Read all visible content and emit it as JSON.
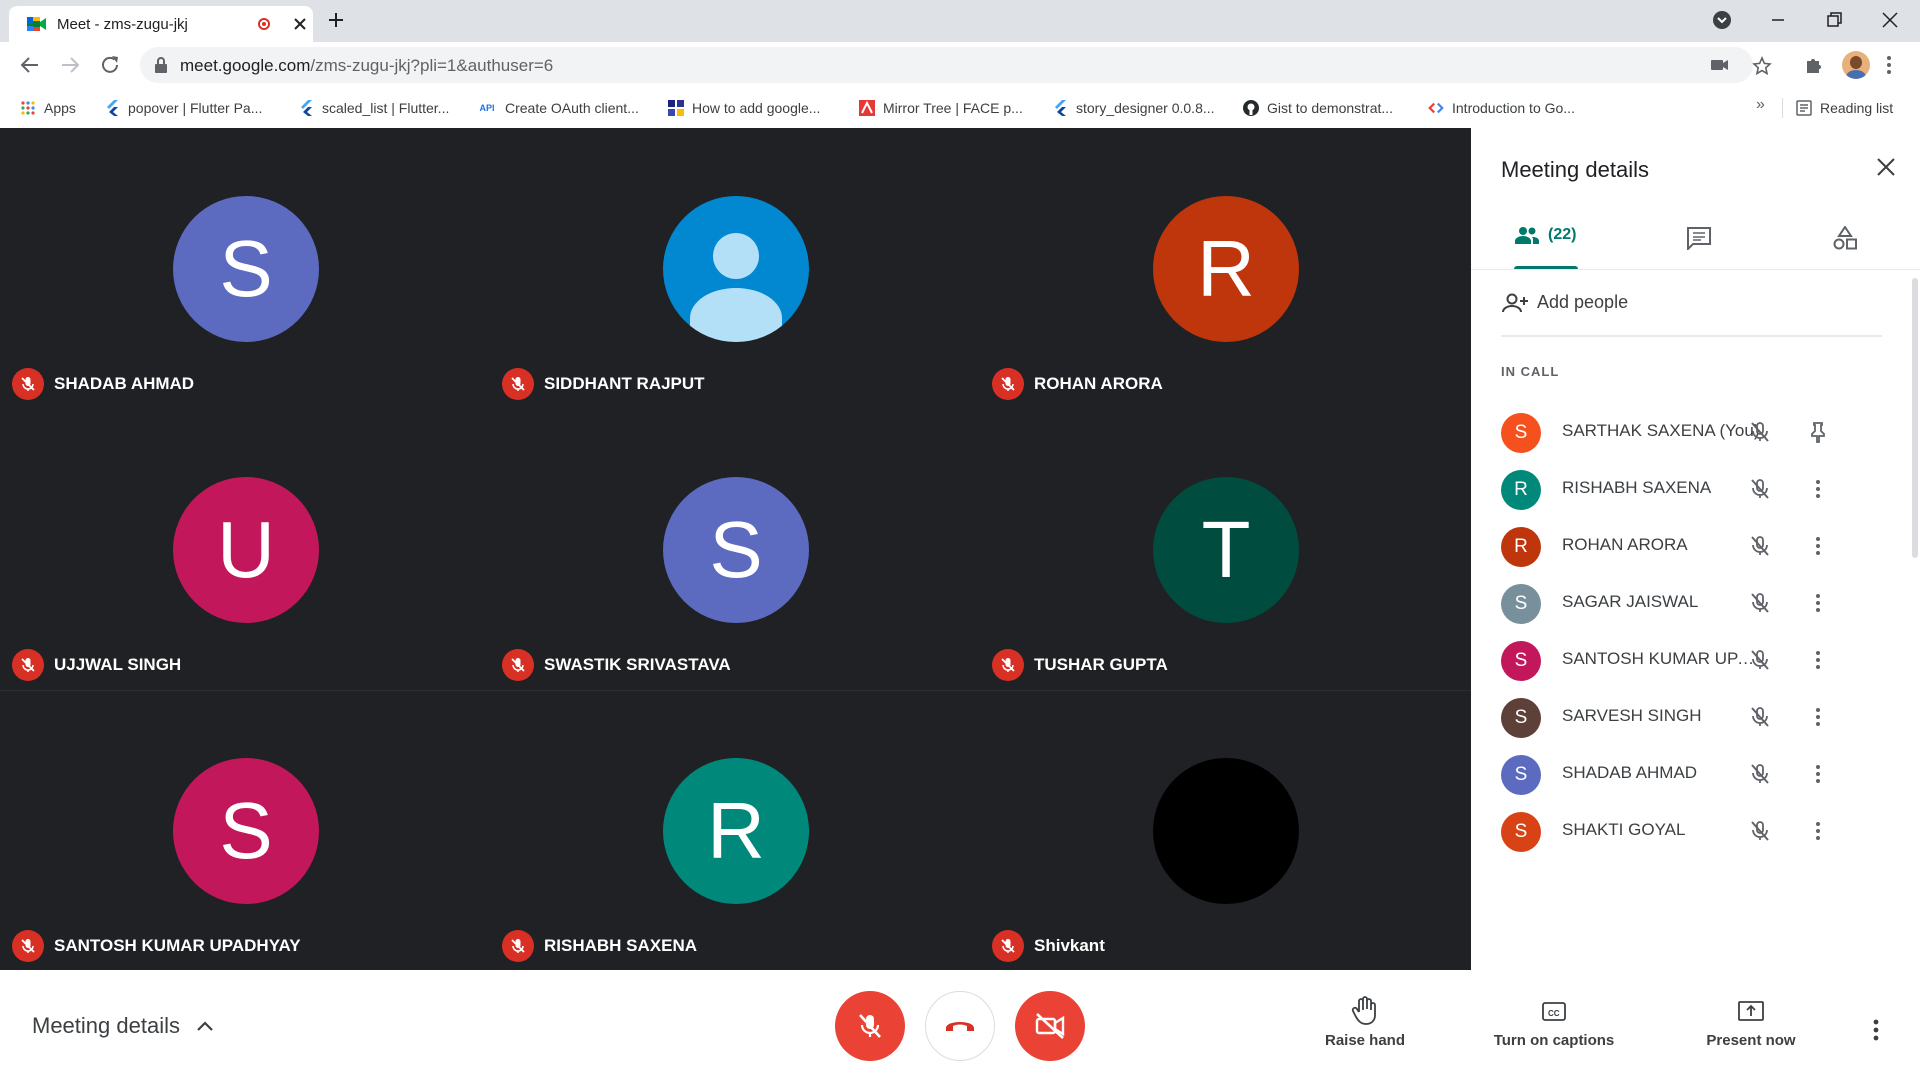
{
  "browser": {
    "tab_title": "Meet - zms-zugu-jkj",
    "url_host": "meet.google.com",
    "url_rest": "/zms-zugu-jkj?pli=1&authuser=6",
    "bookmarks": [
      {
        "label": "Apps",
        "icon": "apps-grid-icon"
      },
      {
        "label": "popover | Flutter Pa...",
        "icon": "flutter-icon"
      },
      {
        "label": "scaled_list | Flutter...",
        "icon": "flutter-icon"
      },
      {
        "label": "Create OAuth client...",
        "icon": "api-icon"
      },
      {
        "label": "How to add google...",
        "icon": "grid-icon"
      },
      {
        "label": "Mirror Tree | FACE p...",
        "icon": "mirror-tree-icon"
      },
      {
        "label": "story_designer 0.0.8...",
        "icon": "flutter-icon"
      },
      {
        "label": "Gist to demonstrat...",
        "icon": "github-icon"
      },
      {
        "label": "Introduction to Go...",
        "icon": "google-developers-icon"
      }
    ],
    "overflow": "»",
    "reading_list": "Reading list"
  },
  "tiles": [
    {
      "initial": "S",
      "name": "SHADAB AHMAD",
      "color": "#5c6bc0"
    },
    {
      "initial": "",
      "name": "SIDDHANT RAJPUT",
      "color": "#0288d1"
    },
    {
      "initial": "R",
      "name": "ROHAN ARORA",
      "color": "#bf360c"
    },
    {
      "initial": "U",
      "name": "UJJWAL SINGH",
      "color": "#c2185b"
    },
    {
      "initial": "S",
      "name": "SWASTIK SRIVASTAVA",
      "color": "#5c6bc0"
    },
    {
      "initial": "T",
      "name": "TUSHAR GUPTA",
      "color": "#004d40"
    },
    {
      "initial": "S",
      "name": "SANTOSH KUMAR UPADHYAY",
      "color": "#c2185b"
    },
    {
      "initial": "R",
      "name": "RISHABH SAXENA",
      "color": "#00897b"
    },
    {
      "initial": "",
      "name": "Shivkant",
      "color": "#000000"
    }
  ],
  "panel": {
    "title": "Meeting details",
    "people_count": "(22)",
    "add_people": "Add people",
    "in_call": "IN CALL",
    "participants": [
      {
        "initial": "S",
        "name": "SARTHAK SAXENA (You)",
        "color": "#f4511e",
        "action": "pin"
      },
      {
        "initial": "R",
        "name": "RISHABH SAXENA",
        "color": "#00897b",
        "action": "more"
      },
      {
        "initial": "R",
        "name": "ROHAN ARORA",
        "color": "#bf360c",
        "action": "more"
      },
      {
        "initial": "S",
        "name": "SAGAR JAISWAL",
        "color": "#78909c",
        "action": "more"
      },
      {
        "initial": "S",
        "name": "SANTOSH KUMAR UPA...",
        "color": "#c2185b",
        "action": "more"
      },
      {
        "initial": "S",
        "name": "SARVESH SINGH",
        "color": "#5d4037",
        "action": "more"
      },
      {
        "initial": "S",
        "name": "SHADAB AHMAD",
        "color": "#5c6bc0",
        "action": "more"
      },
      {
        "initial": "S",
        "name": "SHAKTI GOYAL",
        "color": "#d84315",
        "action": "more"
      }
    ]
  },
  "bottom": {
    "meeting_details": "Meeting details",
    "raise_hand": "Raise hand",
    "captions": "Turn on captions",
    "present": "Present now"
  },
  "colors": {
    "accent": "#00796b",
    "danger": "#ea4335",
    "stage": "#202124"
  }
}
